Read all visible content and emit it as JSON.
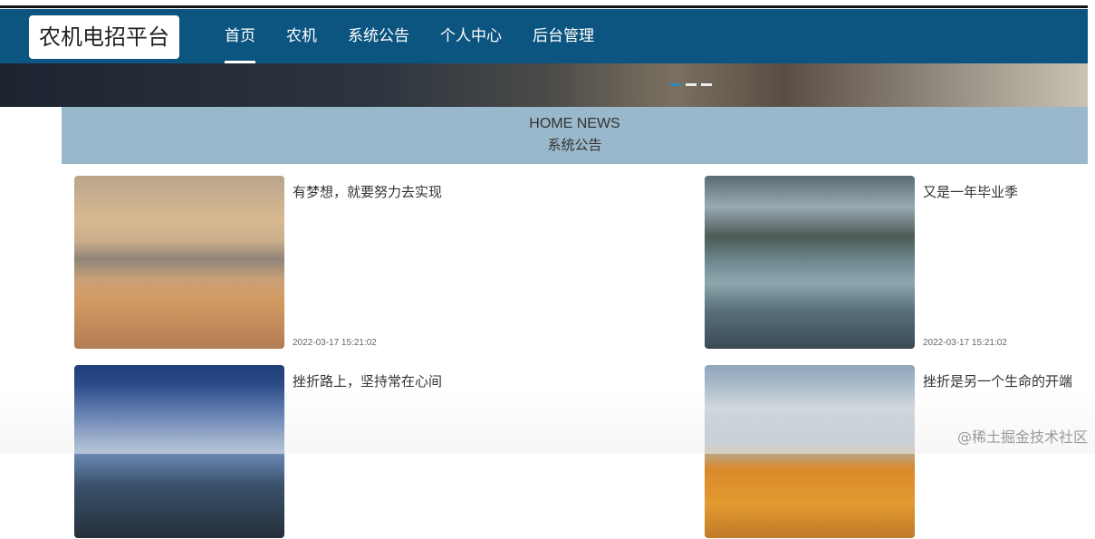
{
  "header": {
    "logo": "农机电招平台",
    "menu": [
      "首页",
      "农机",
      "系统公告",
      "个人中心",
      "后台管理"
    ],
    "active": 0
  },
  "banner": {
    "slides": 3,
    "active": 0
  },
  "section": {
    "title_en": "HOME NEWS",
    "title_cn": "系统公告"
  },
  "news": [
    {
      "title": "有梦想，就要努力去实现",
      "date": "2022-03-17 15:21:02"
    },
    {
      "title": "又是一年毕业季",
      "date": "2022-03-17 15:21:02"
    },
    {
      "title": "挫折路上，坚持常在心间",
      "date": ""
    },
    {
      "title": "挫折是另一个生命的开端",
      "date": ""
    }
  ],
  "watermark": "@稀土掘金技术社区"
}
